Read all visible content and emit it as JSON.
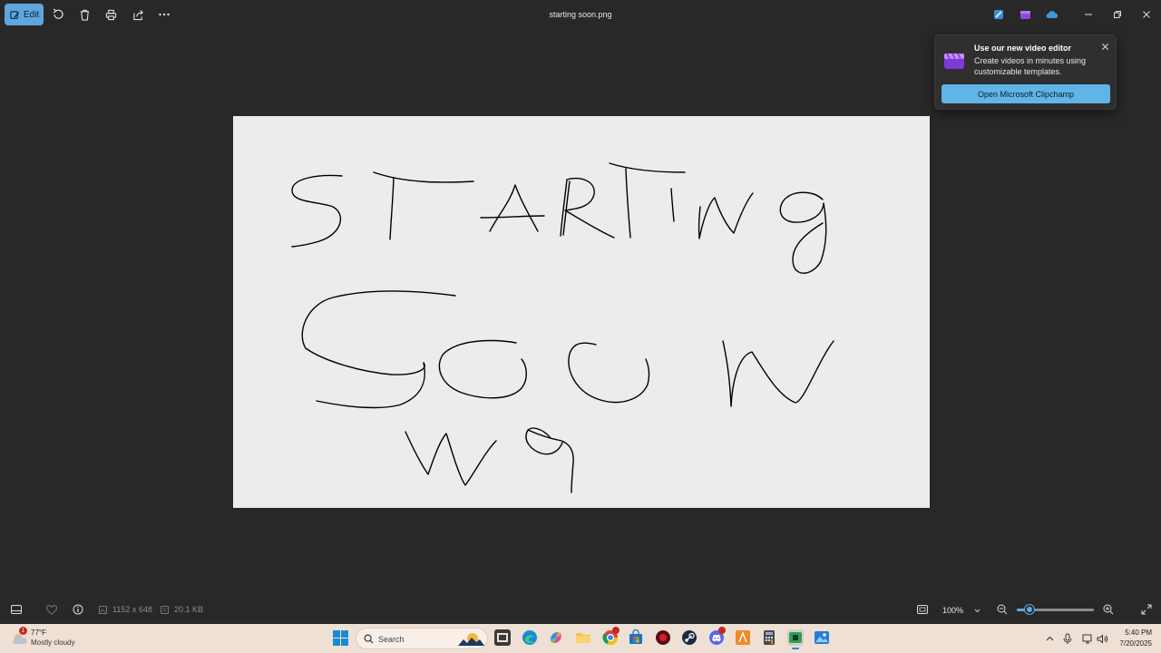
{
  "toolbar": {
    "edit_label": "Edit",
    "file_title": "starting soon.png"
  },
  "popup": {
    "title": "Use our new video editor",
    "body": "Create videos in minutes using customizable templates.",
    "button_label": "Open Microsoft Clipchamp"
  },
  "image": {
    "handwritten_text": "STARTING SOON W9"
  },
  "statusbar": {
    "dimensions": "1152 x 648",
    "file_size": "20.1 KB",
    "zoom": "100%",
    "zoom_level_percent": 16
  },
  "taskbar": {
    "weather_temp": "77°F",
    "weather_condition": "Mostly cloudy",
    "weather_badge": "1",
    "search_placeholder": "Search",
    "time": "5:40 PM",
    "date": "7/20/2025"
  },
  "colors": {
    "accent": "#5ea6df",
    "background": "#282828",
    "canvas": "#ececec",
    "taskbar": "#eee0d4"
  }
}
